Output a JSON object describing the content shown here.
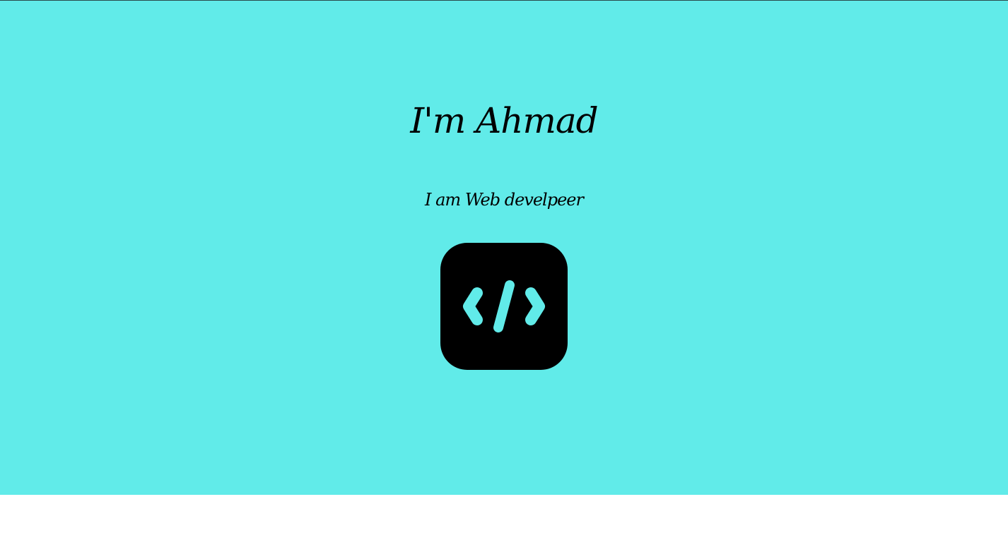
{
  "hero": {
    "title": "I'm Ahmad",
    "subtitle": "I am Web develpeer",
    "background_color": "#61ebe9",
    "logo_icon": "code-icon",
    "logo_background_color": "#000000",
    "logo_glyph_color": "#61ebe9"
  }
}
